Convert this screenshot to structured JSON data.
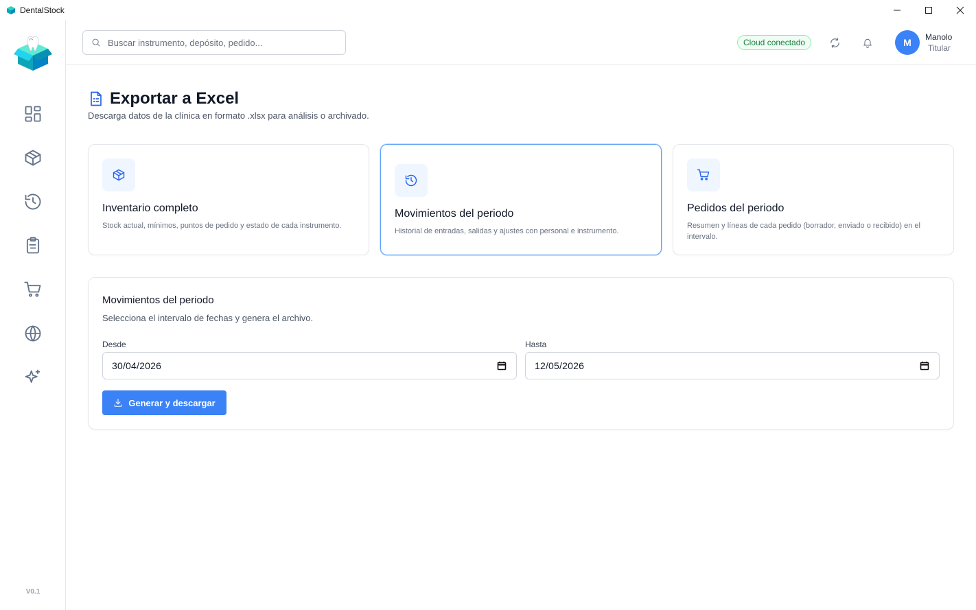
{
  "window": {
    "title": "DentalStock",
    "controls": [
      "minimize",
      "maximize",
      "close"
    ]
  },
  "sidebar": {
    "version": "V0.1",
    "items": [
      {
        "icon": "dashboard-grid-icon"
      },
      {
        "icon": "box-icon"
      },
      {
        "icon": "history-icon"
      },
      {
        "icon": "clipboard-list-icon"
      },
      {
        "icon": "shopping-cart-icon"
      },
      {
        "icon": "globe-icon"
      },
      {
        "icon": "sparkles-icon"
      }
    ]
  },
  "header": {
    "search_placeholder": "Buscar instrumento, depósito, pedido...",
    "cloud_status": "Cloud conectado",
    "user": {
      "initial": "M",
      "name": "Manolo",
      "role": "Titular"
    }
  },
  "page": {
    "title": "Exportar a Excel",
    "subtitle": "Descarga datos de la clínica en formato .xlsx para análisis o archivado."
  },
  "export_options": [
    {
      "icon": "box-icon",
      "title": "Inventario completo",
      "description": "Stock actual, mínimos, puntos de pedido y estado de cada instrumento.",
      "selected": false
    },
    {
      "icon": "history-icon",
      "title": "Movimientos del periodo",
      "description": "Historial de entradas, salidas y ajustes con personal e instrumento.",
      "selected": true
    },
    {
      "icon": "shopping-cart-icon",
      "title": "Pedidos del periodo",
      "description": "Resumen y líneas de cada pedido (borrador, enviado o recibido) en el intervalo.",
      "selected": false
    }
  ],
  "form": {
    "title": "Movimientos del periodo",
    "subtitle": "Selecciona el intervalo de fechas y genera el archivo.",
    "from_label": "Desde",
    "from_value": "30/04/2026",
    "to_label": "Hasta",
    "to_value": "12/05/2026",
    "button_label": "Generar y descargar"
  },
  "colors": {
    "accent": "#3b82f6",
    "accent_dark": "#2563eb",
    "icon_bg": "#eff6ff",
    "cloud_green": "#15803d",
    "cloud_bg": "#f0fdf4",
    "logo_teal": "#14b8a6"
  }
}
